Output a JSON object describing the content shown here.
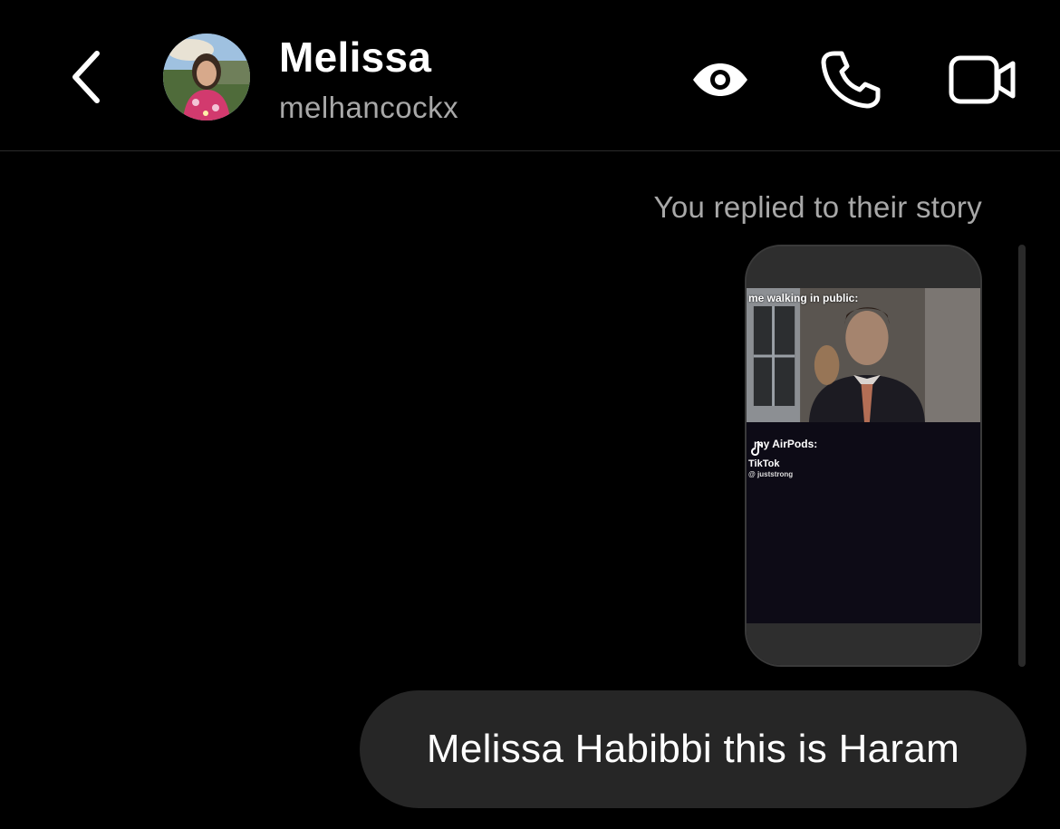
{
  "header": {
    "name": "Melissa",
    "username": "melhancockx",
    "icons": {
      "back": "chevron-left-icon",
      "view": "eye-icon",
      "call": "phone-icon",
      "video": "video-camera-icon"
    }
  },
  "conversation": {
    "replied_note": "You replied to their story",
    "story": {
      "caption_top": "me walking in public:",
      "caption_bottom": "my AirPods:",
      "watermark_brand": "TikTok",
      "watermark_handle": "@ juststrong"
    },
    "message": "Melissa Habibbi this is Haram"
  },
  "colors": {
    "background": "#000000",
    "bubble": "#262626",
    "secondary_text": "#a8a8a8"
  }
}
